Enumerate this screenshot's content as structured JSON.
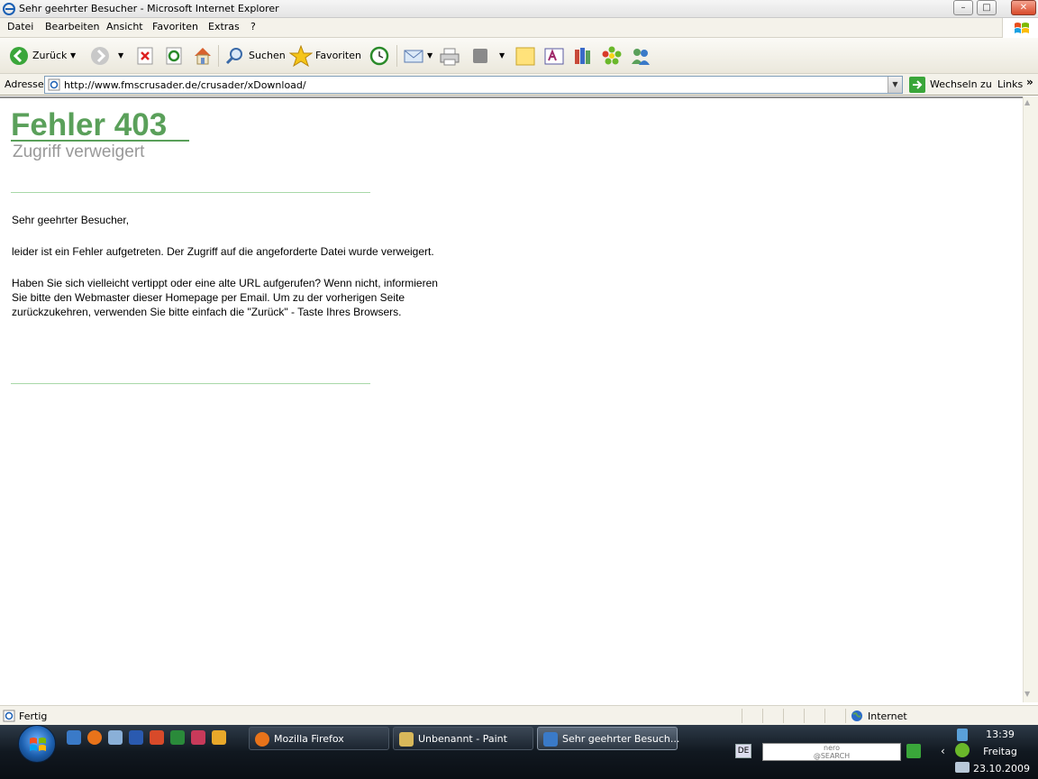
{
  "window": {
    "title": "Sehr geehrter Besucher - Microsoft Internet Explorer",
    "min_label": "–",
    "max_label": "□",
    "close_label": "✕"
  },
  "menu": {
    "items": [
      "Datei",
      "Bearbeiten",
      "Ansicht",
      "Favoriten",
      "Extras",
      "?"
    ]
  },
  "toolbar": {
    "back_label": "Zurück",
    "search_label": "Suchen",
    "favorites_label": "Favoriten"
  },
  "address": {
    "label": "Adresse",
    "url": "http://www.fmscrusader.de/crusader/xDownload/",
    "go_label": "Wechseln zu",
    "links_label": "Links"
  },
  "page": {
    "error_code": "Fehler 403",
    "error_title": "Zugriff verweigert",
    "greeting": "Sehr geehrter Besucher,",
    "line1": "leider ist ein Fehler aufgetreten. Der Zugriff auf die angeforderte Datei wurde verweigert.",
    "line2a": "Haben Sie sich vielleicht vertippt oder eine alte URL aufgerufen? Wenn nicht, informieren",
    "line2b": "Sie bitte den Webmaster dieser Homepage per Email. Um zu der vorherigen Seite",
    "line2c": "zurückzukehren, verwenden Sie bitte einfach die \"Zurück\" - Taste Ihres Browsers.",
    "accent_color": "#5aa05a"
  },
  "status": {
    "text": "Fertig",
    "zone": "Internet"
  },
  "taskbar": {
    "tasks": [
      {
        "label": "Mozilla Firefox",
        "icon": "firefox-icon"
      },
      {
        "label": "Unbenannt - Paint",
        "icon": "paint-icon"
      },
      {
        "label": "Sehr geehrter Besuch...",
        "icon": "ie-icon"
      }
    ],
    "language": "DE",
    "search_brand": "nero\n@SEARCH",
    "time": "13:39",
    "day": "Freitag",
    "date": "23.10.2009"
  }
}
